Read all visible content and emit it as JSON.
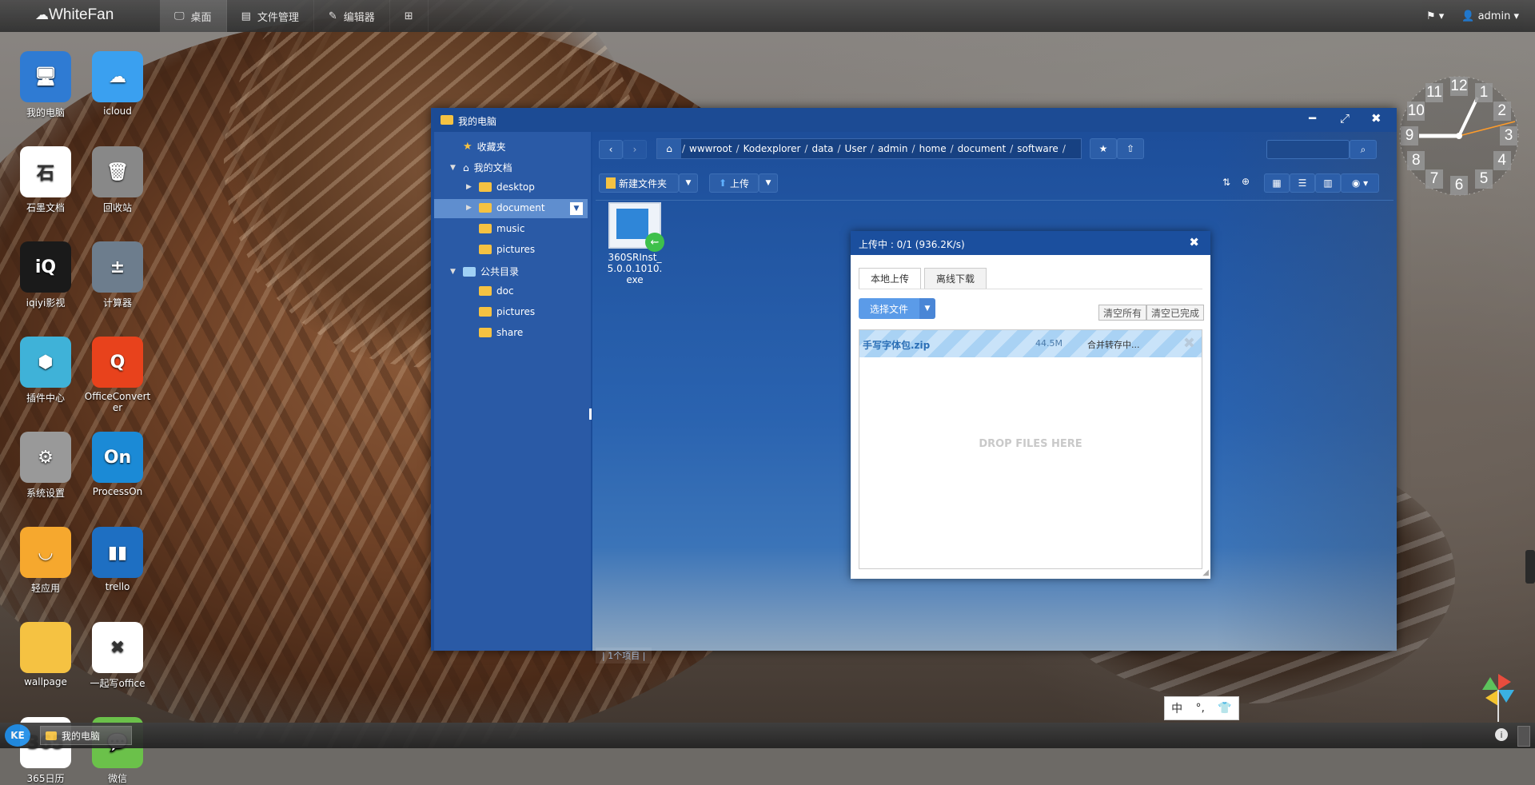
{
  "topbar": {
    "logo": "WhiteFan",
    "nav": [
      {
        "label": "桌面",
        "icon": "monitor-icon"
      },
      {
        "label": "文件管理",
        "icon": "file-manager-icon"
      },
      {
        "label": "编辑器",
        "icon": "edit-icon"
      },
      {
        "label": "",
        "icon": "grid-icon"
      }
    ],
    "user": "admin"
  },
  "desktop_icons": [
    {
      "label": "我的电脑",
      "icon": "computer-icon",
      "color": "#2f7bd3"
    },
    {
      "label": "icloud",
      "icon": "icloud-icon",
      "color": "#3aa0f0"
    },
    {
      "label": "石墨文档",
      "icon": "shimo-icon",
      "color": "#ffffff"
    },
    {
      "label": "回收站",
      "icon": "trash-icon",
      "color": "#888888"
    },
    {
      "label": "iqiyi影视",
      "icon": "iqiyi-icon",
      "color": "#1a1a1a"
    },
    {
      "label": "计算器",
      "icon": "calculator-icon",
      "color": "#6d7d8d"
    },
    {
      "label": "插件中心",
      "icon": "plugin-icon",
      "color": "#3fb2d8"
    },
    {
      "label": "OfficeConverter",
      "icon": "office-converter-icon",
      "color": "#e8421c"
    },
    {
      "label": "系统设置",
      "icon": "settings-icon",
      "color": "#999999"
    },
    {
      "label": "ProcessOn",
      "icon": "processon-icon",
      "color": "#1b8ad6"
    },
    {
      "label": "轻应用",
      "icon": "light-app-icon",
      "color": "#f6a82e"
    },
    {
      "label": "trello",
      "icon": "trello-icon",
      "color": "#1e6fc2"
    },
    {
      "label": "wallpage",
      "icon": "folder-icon",
      "color": "#f5c242"
    },
    {
      "label": "一起写office",
      "icon": "yiqixie-icon",
      "color": "#ffffff"
    },
    {
      "label": "365日历",
      "icon": "calendar-icon",
      "color": "#ffffff"
    },
    {
      "label": "微信",
      "icon": "wechat-icon",
      "color": "#6bc14a"
    }
  ],
  "window": {
    "title": "我的电脑",
    "sidebar": {
      "favorites": "收藏夹",
      "my_docs": "我的文档",
      "my_docs_children": [
        "desktop",
        "document",
        "music",
        "pictures"
      ],
      "public": "公共目录",
      "public_children": [
        "doc",
        "pictures",
        "share"
      ]
    },
    "path": [
      "wwwroot",
      "Kodexplorer",
      "data",
      "User",
      "admin",
      "home",
      "document",
      "software"
    ],
    "toolbar": {
      "new_folder": "新建文件夹",
      "upload": "上传"
    },
    "file": {
      "name": "360SRInst_5.0.0.1010.exe"
    },
    "status": "| 1个项目 |"
  },
  "upload_dialog": {
    "title": "上传中 : 0/1 (936.2K/s)",
    "tabs": [
      "本地上传",
      "离线下载"
    ],
    "select_file": "选择文件",
    "clear_all": "清空所有",
    "clear_done": "清空已完成",
    "item": {
      "name": "手写字体包.zip",
      "size": "44.5M",
      "status": "合并转存中..."
    },
    "drop_text": "DROP FILES HERE"
  },
  "taskbar": {
    "start": "KE",
    "task": "我的电脑"
  },
  "ime": [
    "中",
    "°,",
    "👕"
  ],
  "clock": {
    "numbers": [
      "12",
      "1",
      "2",
      "3",
      "4",
      "5",
      "6",
      "7",
      "8",
      "9",
      "10",
      "11"
    ]
  }
}
